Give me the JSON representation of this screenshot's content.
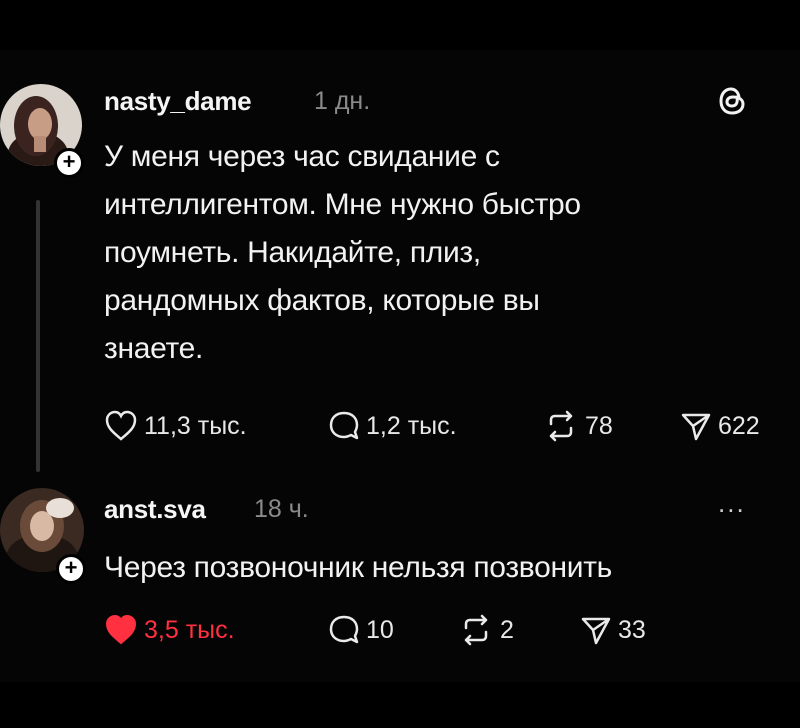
{
  "posts": [
    {
      "username": "nasty_dame",
      "time": "1 дн.",
      "text_lines": [
        "У меня через час свидание с",
        "интеллигентом. Мне нужно быстро",
        "поумнеть. Накидайте, плиз,",
        "рандомных фактов, которые вы",
        "знаете."
      ],
      "actions": {
        "likes": "11,3 тыс.",
        "replies": "1,2 тыс.",
        "reposts": "78",
        "shares": "622"
      }
    },
    {
      "username": "anst.sva",
      "time": "18 ч.",
      "text_lines": [
        "Через позвоночник нельзя позвонить"
      ],
      "actions": {
        "likes": "3,5 тыс.",
        "replies": "10",
        "reposts": "2",
        "shares": "33"
      },
      "liked": true
    }
  ],
  "icons": {
    "like": "heart-icon",
    "reply": "speech-bubble-icon",
    "repost": "repost-arrows-icon",
    "share": "send-icon",
    "brand": "threads-logo-icon",
    "more": "more-dots-icon"
  },
  "colors": {
    "background": "#000000",
    "liked": "#ff3040",
    "muted": "#8a8a8a"
  },
  "more_label": "..."
}
